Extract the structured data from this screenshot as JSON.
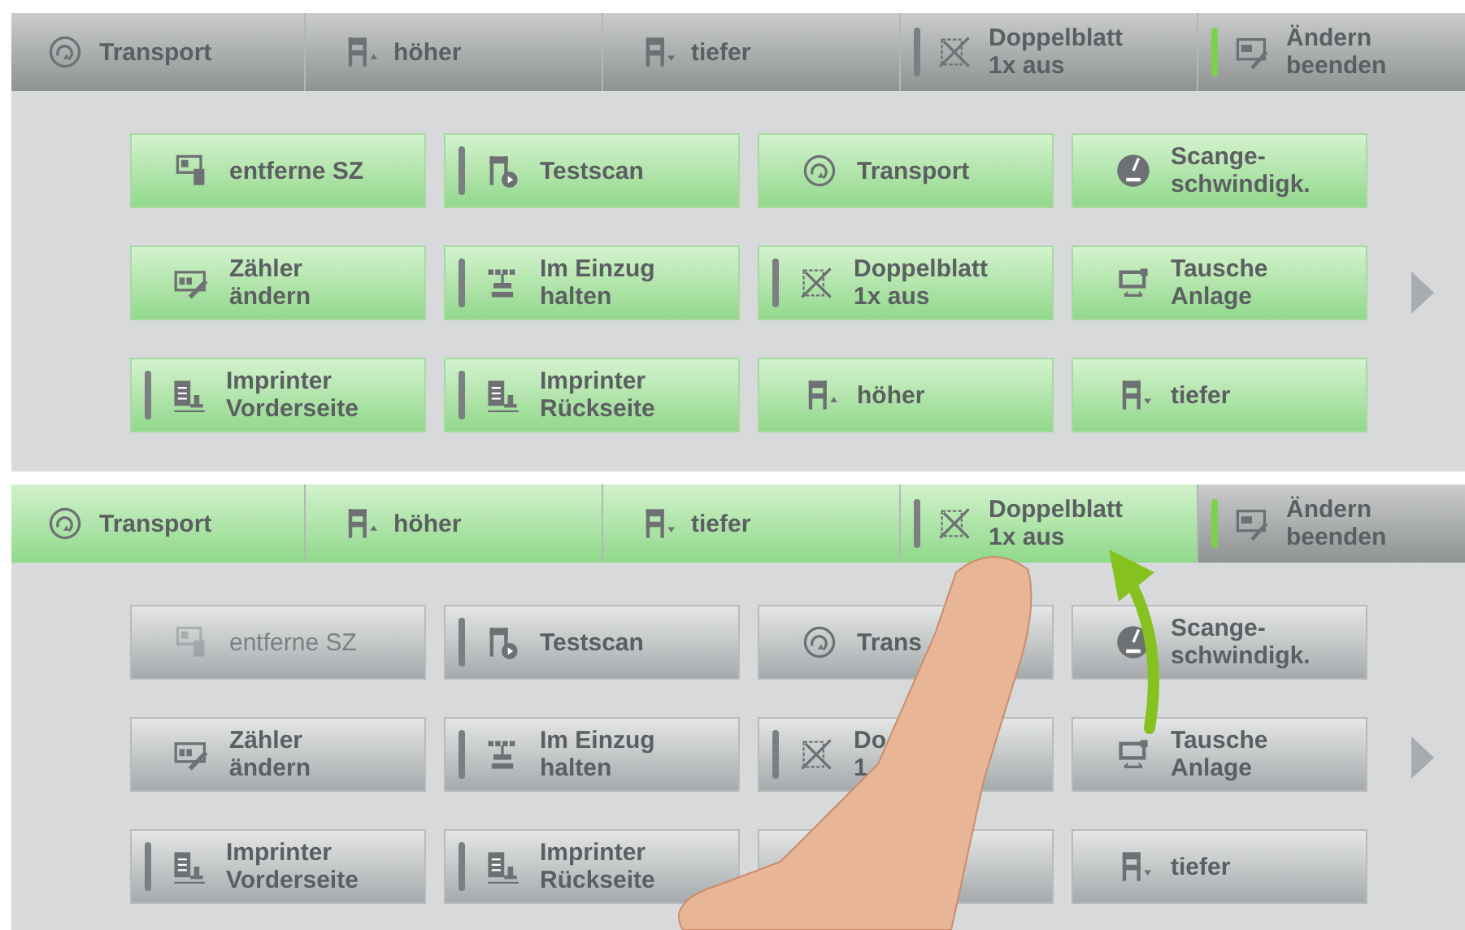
{
  "panels": [
    {
      "toolbar": [
        {
          "kind": "transport",
          "lines": [
            "Transport"
          ],
          "highlighted": false
        },
        {
          "kind": "raise",
          "lines": [
            "höher"
          ],
          "highlighted": false
        },
        {
          "kind": "lower",
          "lines": [
            "tiefer"
          ],
          "highlighted": false
        },
        {
          "kind": "double",
          "lines": [
            "Doppelblatt",
            "1x aus"
          ],
          "highlighted": false,
          "toggle": false
        },
        {
          "kind": "edit",
          "lines": [
            "Ändern",
            "beenden"
          ],
          "highlighted": false,
          "toggle": true
        }
      ],
      "grid": [
        {
          "kind": "card",
          "lines": [
            "entferne SZ"
          ],
          "highlighted": true,
          "disabled": false
        },
        {
          "kind": "testscan",
          "lines": [
            "Testscan"
          ],
          "highlighted": true,
          "disabled": false,
          "toggle": false
        },
        {
          "kind": "transport",
          "lines": [
            "Transport"
          ],
          "highlighted": true,
          "disabled": false
        },
        {
          "kind": "gauge",
          "lines": [
            "Scange-",
            "schwindigk."
          ],
          "highlighted": true,
          "disabled": false
        },
        {
          "kind": "counter",
          "lines": [
            "Zähler",
            "ändern"
          ],
          "highlighted": true,
          "disabled": false
        },
        {
          "kind": "feeder",
          "lines": [
            "Im Einzug",
            "halten"
          ],
          "highlighted": true,
          "disabled": false,
          "toggle": false
        },
        {
          "kind": "double",
          "lines": [
            "Doppelblatt",
            "1x aus"
          ],
          "highlighted": true,
          "disabled": false,
          "toggle": false
        },
        {
          "kind": "swap",
          "lines": [
            "Tausche",
            "Anlage"
          ],
          "highlighted": true,
          "disabled": false
        },
        {
          "kind": "imprinter",
          "lines": [
            "Imprinter",
            "Vorderseite"
          ],
          "highlighted": true,
          "disabled": false,
          "toggle": false
        },
        {
          "kind": "imprinter",
          "lines": [
            "Imprinter",
            "Rückseite"
          ],
          "highlighted": true,
          "disabled": false,
          "toggle": false
        },
        {
          "kind": "raise",
          "lines": [
            "höher"
          ],
          "highlighted": true,
          "disabled": false
        },
        {
          "kind": "lower",
          "lines": [
            "tiefer"
          ],
          "highlighted": true,
          "disabled": false
        }
      ],
      "finger": false
    },
    {
      "toolbar": [
        {
          "kind": "transport",
          "lines": [
            "Transport"
          ],
          "highlighted": true
        },
        {
          "kind": "raise",
          "lines": [
            "höher"
          ],
          "highlighted": true
        },
        {
          "kind": "lower",
          "lines": [
            "tiefer"
          ],
          "highlighted": true
        },
        {
          "kind": "double",
          "lines": [
            "Doppelblatt",
            "1x aus"
          ],
          "highlighted": true,
          "toggle": false
        },
        {
          "kind": "edit",
          "lines": [
            "Ändern",
            "beenden"
          ],
          "highlighted": false,
          "toggle": true
        }
      ],
      "grid": [
        {
          "kind": "card",
          "lines": [
            "entferne SZ"
          ],
          "highlighted": false,
          "disabled": true
        },
        {
          "kind": "testscan",
          "lines": [
            "Testscan"
          ],
          "highlighted": false,
          "disabled": false,
          "toggle": false
        },
        {
          "kind": "transport",
          "lines": [
            "Trans"
          ],
          "highlighted": false,
          "disabled": false
        },
        {
          "kind": "gauge",
          "lines": [
            "Scange-",
            "schwindigk."
          ],
          "highlighted": false,
          "disabled": false
        },
        {
          "kind": "counter",
          "lines": [
            "Zähler",
            "ändern"
          ],
          "highlighted": false,
          "disabled": false
        },
        {
          "kind": "feeder",
          "lines": [
            "Im Einzug",
            "halten"
          ],
          "highlighted": false,
          "disabled": false,
          "toggle": false
        },
        {
          "kind": "double",
          "lines": [
            "Do",
            "1"
          ],
          "highlighted": false,
          "disabled": false,
          "toggle": false
        },
        {
          "kind": "swap",
          "lines": [
            "Tausche",
            "Anlage"
          ],
          "highlighted": false,
          "disabled": false
        },
        {
          "kind": "imprinter",
          "lines": [
            "Imprinter",
            "Vorderseite"
          ],
          "highlighted": false,
          "disabled": false,
          "toggle": false
        },
        {
          "kind": "imprinter",
          "lines": [
            "Imprinter",
            "Rückseite"
          ],
          "highlighted": false,
          "disabled": false,
          "toggle": false
        },
        {
          "kind": "raise",
          "highlighted": false
        },
        {
          "kind": "lower",
          "lines": [
            "tiefer"
          ],
          "highlighted": false,
          "disabled": false
        }
      ],
      "finger": true
    }
  ]
}
